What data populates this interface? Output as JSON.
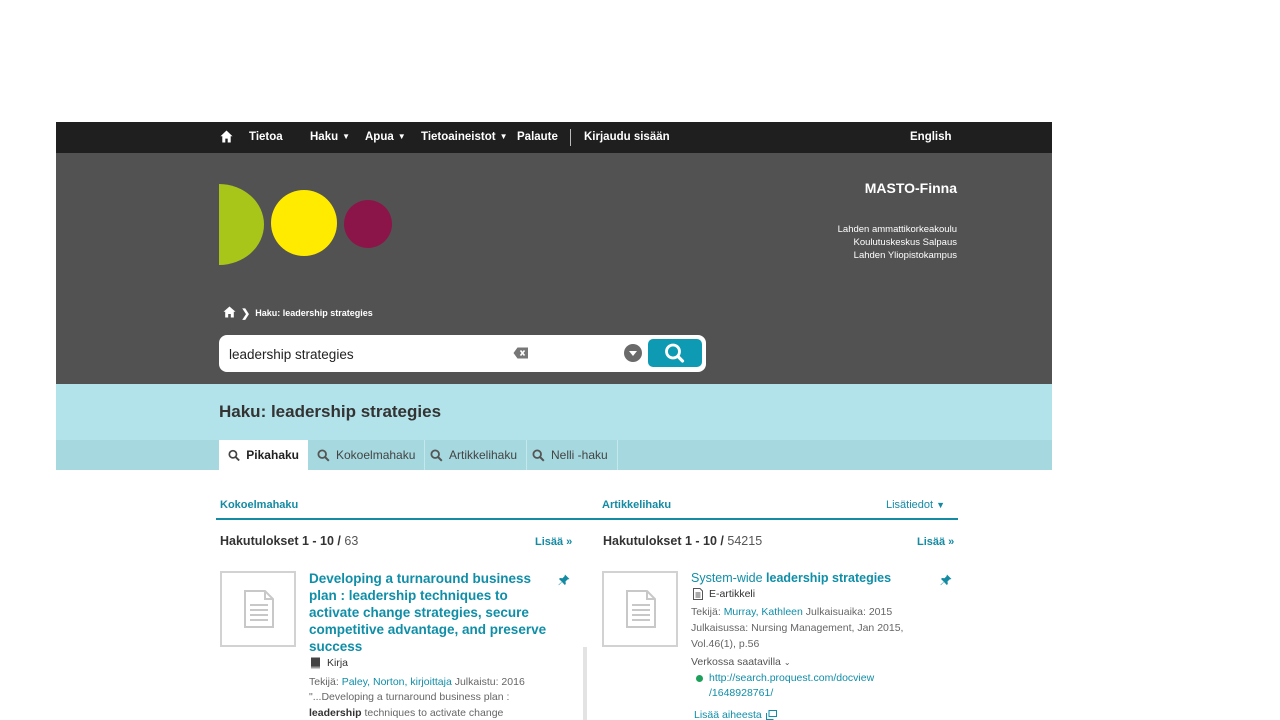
{
  "nav": {
    "items": [
      "Tietoa",
      "Haku",
      "Apua",
      "Tietoaineistot",
      "Palaute"
    ],
    "login": "Kirjaudu sisään",
    "language": "English"
  },
  "header": {
    "brand": "MASTO-Finna",
    "orgs": [
      "Lahden ammattikorkeakoulu",
      "Koulutuskeskus Salpaus",
      "Lahden Yliopistokampus"
    ],
    "logo_colors": [
      "#a8c61a",
      "#ffeb00",
      "#8b1548"
    ],
    "breadcrumb": "Haku: leadership strategies"
  },
  "search": {
    "value": "leadership strategies"
  },
  "band": {
    "title": "Haku: leadership strategies",
    "tabs": [
      "Pikahaku",
      "Kokoelmahaku",
      "Artikkelihaku",
      "Nelli -haku"
    ],
    "active_tab": "Pikahaku"
  },
  "colors": {
    "accent": "#148aa3",
    "nav_bg": "#1f1f1f",
    "header_bg": "#535253",
    "band_bg": "#b3e3ea",
    "search_btn": "#0e9ab2"
  },
  "left": {
    "heading": "Kokoelmahaku",
    "results_label": "Hakutulokset 1 - 10",
    "total": "63",
    "more": "Lisää »",
    "item": {
      "title": "Developing a turnaround business plan : leadership techniques to activate change strategies, secure competitive advantage, and preserve success",
      "format": "Kirja",
      "author_label": "Tekijä:",
      "author": "Paley, Norton, kirjoittaja",
      "published_label": "Julkaistu:",
      "published": "2016",
      "snippet_pre": "\"...Developing a turnaround business plan :",
      "snippet_bold": "leadership",
      "snippet_post": "techniques to activate change"
    }
  },
  "right": {
    "heading": "Artikkelihaku",
    "details": "Lisätiedot",
    "results_label": "Hakutulokset 1 - 10",
    "total": "54215",
    "more": "Lisää »",
    "item": {
      "title_pre": "System-wide",
      "title_bold": "leadership strategies",
      "format": "E-artikkeli",
      "author_label": "Tekijä:",
      "author": "Murray, Kathleen",
      "date_label": "Julkaisuaika:",
      "date": "2015",
      "source_label": "Julkaisussa:",
      "source": "Nursing Management, Jan 2015,",
      "source2": "Vol.46(1), p.56",
      "online": "Verkossa saatavilla",
      "url1": "http://search.proquest.com/docview",
      "url2": "/1648928761/",
      "similar": "Lisää aiheesta"
    }
  }
}
